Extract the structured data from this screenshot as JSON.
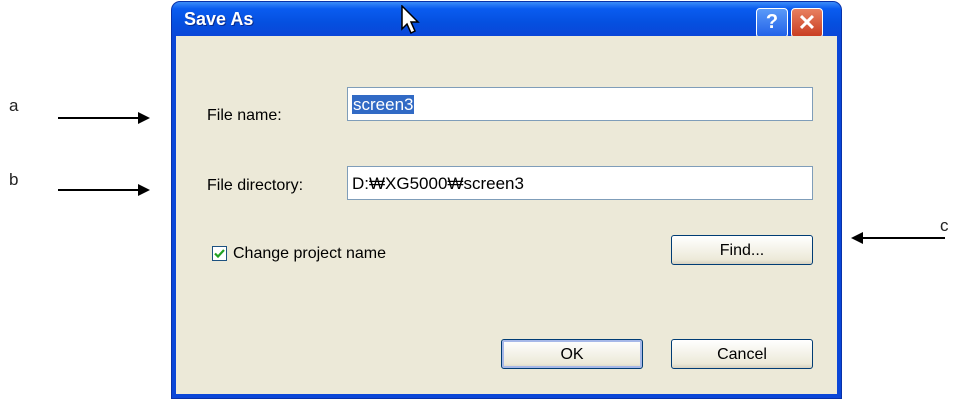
{
  "annotations": {
    "a": "a",
    "b": "b",
    "c": "c"
  },
  "dialog": {
    "title": "Save As",
    "help_button": "?",
    "close_button": "✕",
    "file_name_label": "File name:",
    "file_name_value": "screen3",
    "file_directory_label": "File directory:",
    "file_directory_value": "D:₩XG5000₩screen3",
    "checkbox_label": "Change project name",
    "checkbox_checked": true,
    "find_label": "Find...",
    "ok_label": "OK",
    "cancel_label": "Cancel"
  },
  "colors": {
    "titlebar": "#0a46d8",
    "client": "#ece9d8",
    "selection": "#316ac5"
  }
}
